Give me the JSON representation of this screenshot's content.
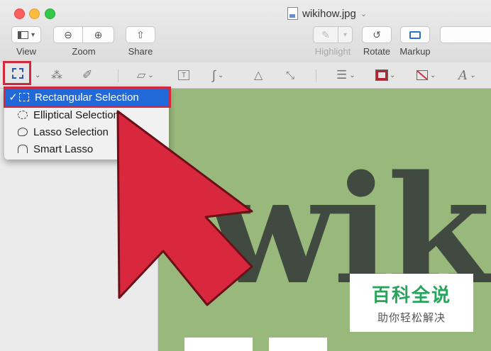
{
  "window": {
    "title": "wikihow.jpg"
  },
  "toolbar": {
    "view_label": "View",
    "zoom_label": "Zoom",
    "share_label": "Share",
    "highlight_label": "Highlight",
    "rotate_label": "Rotate",
    "markup_label": "Markup"
  },
  "selection_menu": {
    "items": [
      {
        "label": "Rectangular Selection",
        "selected": true,
        "icon": "rectangular-selection-icon"
      },
      {
        "label": "Elliptical Selection",
        "selected": false,
        "icon": "elliptical-selection-icon"
      },
      {
        "label": "Lasso Selection",
        "selected": false,
        "icon": "lasso-selection-icon"
      },
      {
        "label": "Smart Lasso",
        "selected": false,
        "icon": "smart-lasso-icon"
      }
    ],
    "checkmark": "✓"
  },
  "document": {
    "logo_text": "wik"
  },
  "watermark": {
    "title": "百科全说",
    "subtitle": "助你轻松解决"
  },
  "colors": {
    "accent_red": "#d2293f",
    "selection_blue": "#2168d8",
    "canvas_green": "#99b97c",
    "logo_dark": "#414a40",
    "watermark_green": "#27a55a"
  }
}
